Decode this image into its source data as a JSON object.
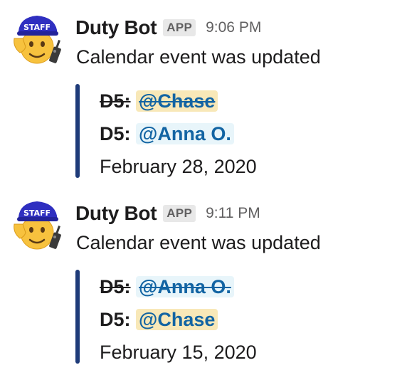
{
  "messages": [
    {
      "sender": "Duty Bot",
      "badge": "APP",
      "time": "9:06 PM",
      "text": "Calendar event was updated",
      "avatar_icon": "saluting-staff-emoji-icon",
      "attachment": {
        "accent_color": "#1e3b79",
        "old_label": "D5:",
        "old_mention": "@Chase",
        "new_label": "D5:",
        "new_mention": "@Anna O.",
        "date": "February 28, 2020"
      }
    },
    {
      "sender": "Duty Bot",
      "badge": "APP",
      "time": "9:11 PM",
      "text": "Calendar event was updated",
      "avatar_icon": "saluting-staff-emoji-icon",
      "attachment": {
        "accent_color": "#1e3b79",
        "old_label": "D5:",
        "old_mention": "@Anna O.",
        "new_label": "D5:",
        "new_mention": "@Chase",
        "date": "February 15, 2020"
      }
    }
  ],
  "avatar": {
    "cap_text": "STAFF"
  },
  "colors": {
    "mention_text": "#1264a3",
    "self_mention_bg": "#f8e8b8",
    "other_mention_bg": "#e8f5fa",
    "cap_blue": "#2f2fc0"
  }
}
